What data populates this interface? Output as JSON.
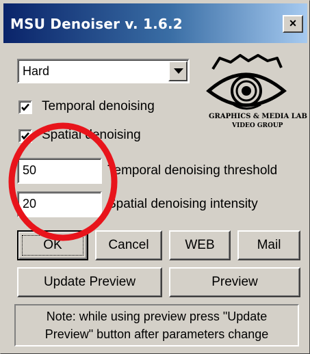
{
  "window": {
    "title": "MSU Denoiser v. 1.6.2",
    "close_label": "×"
  },
  "mode_select": {
    "selected": "Hard"
  },
  "options": {
    "temporal_label": "Temporal denoising",
    "temporal_checked": true,
    "spatial_label": "Spatial denoising",
    "spatial_checked": true
  },
  "logo": {
    "line1": "GRAPHICS & MEDIA LAB",
    "line2": "VIDEO GROUP"
  },
  "fields": {
    "temporal_threshold_value": "50",
    "temporal_threshold_label": "Temporal denoising threshold",
    "spatial_intensity_value": "20",
    "spatial_intensity_label": "Spatial denoising intensity"
  },
  "buttons": {
    "ok": "OK",
    "cancel": "Cancel",
    "web": "WEB",
    "mail": "Mail",
    "update_preview": "Update Preview",
    "preview": "Preview"
  },
  "note": {
    "line1": "Note: while using preview press \"Update",
    "line2": "Preview\" button after parameters change"
  },
  "colors": {
    "dialog_face": "#d4d0c8",
    "titlebar_start": "#0a246a",
    "titlebar_end": "#a6caf0",
    "annotation_circle": "#e8141b"
  }
}
